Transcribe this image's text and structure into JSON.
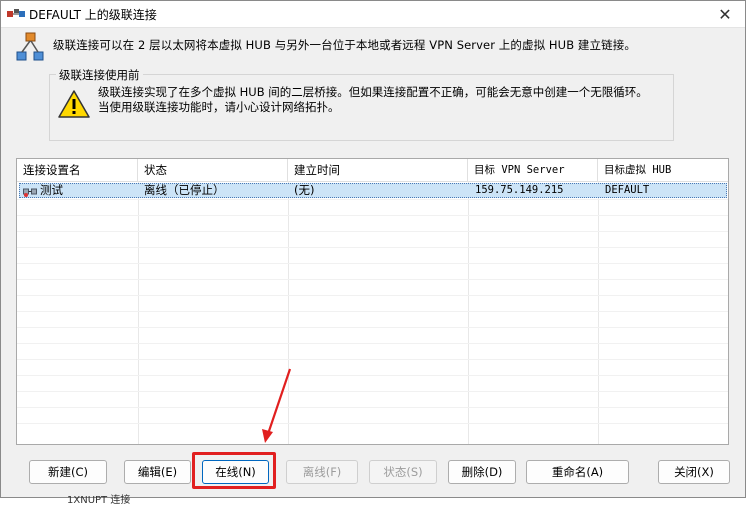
{
  "window": {
    "title": "DEFAULT 上的级联连接",
    "close_glyph": "✕"
  },
  "description": "级联连接可以在 2 层以太网将本虚拟 HUB 与另外一台位于本地或者远程 VPN Server 上的虚拟 HUB 建立链接。",
  "warning": {
    "title": "级联连接使用前",
    "text": "级联连接实现了在多个虚拟 HUB 间的二层桥接。但如果连接配置不正确，可能会无意中创建一个无限循环。当使用级联连接功能时，请小心设计网络拓扑。"
  },
  "table": {
    "columns": [
      "连接设置名",
      "状态",
      "建立时间",
      "目标 VPN Server",
      "目标虚拟 HUB"
    ],
    "rows": [
      {
        "name": "测试",
        "status": "离线（已停止）",
        "time": "(无)",
        "server": "159.75.149.215",
        "hub": "DEFAULT"
      }
    ]
  },
  "buttons": {
    "new": "新建(C)",
    "edit": "编辑(E)",
    "online": "在线(N)",
    "offline": "离线(F)",
    "status": "状态(S)",
    "delete": "删除(D)",
    "rename": "重命名(A)",
    "close": "关闭(X)"
  },
  "background_text": "1XNUPT 连接",
  "colors": {
    "selection": "#cce4f7",
    "annotation": "#e11f1f",
    "warning_yellow": "#ffd800"
  }
}
